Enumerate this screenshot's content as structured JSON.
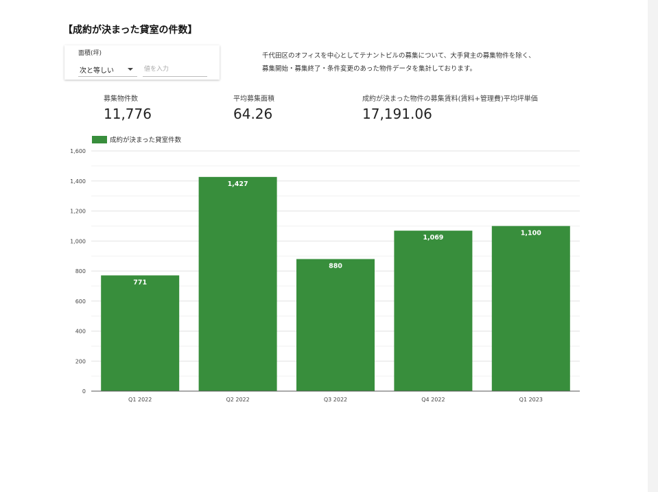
{
  "page": {
    "title": "【成約が決まった貸室の件数】"
  },
  "filter": {
    "label": "面積(坪)",
    "operator": "次と等しい",
    "value": "",
    "placeholder": "値を入力"
  },
  "description": {
    "line1": "千代田区のオフィスを中心としてテナントビルの募集について、大手貸主の募集物件を除く、",
    "line2": "募集開始・募集終了・条件変更のあった物件データを集計しております。"
  },
  "kpis": [
    {
      "label": "募集物件数",
      "value": "11,776"
    },
    {
      "label": "平均募集面積",
      "value": "64.26"
    },
    {
      "label": "成約が決まった物件の募集賃料(賃料+管理費)平均坪単価",
      "value": "17,191.06"
    }
  ],
  "colors": {
    "bar": "#388e3c",
    "grid": "#e6e6e6",
    "axis": "#555555"
  },
  "chart_data": {
    "type": "bar",
    "categories": [
      "Q1 2022",
      "Q2 2022",
      "Q3 2022",
      "Q4 2022",
      "Q1 2023"
    ],
    "series": [
      {
        "name": "成約が決まった貸室件数",
        "values": [
          771,
          1427,
          880,
          1069,
          1100
        ]
      }
    ],
    "value_labels": [
      "771",
      "1,427",
      "880",
      "1,069",
      "1,100"
    ],
    "ylim": [
      0,
      1600
    ],
    "yticks": [
      0,
      200,
      400,
      600,
      800,
      1000,
      1200,
      1400,
      1600
    ],
    "ytick_labels": [
      "0",
      "200",
      "400",
      "600",
      "800",
      "1,000",
      "1,200",
      "1,400",
      "1,600"
    ],
    "grid": true,
    "legend": "top-left",
    "xlabel": "",
    "ylabel": ""
  }
}
